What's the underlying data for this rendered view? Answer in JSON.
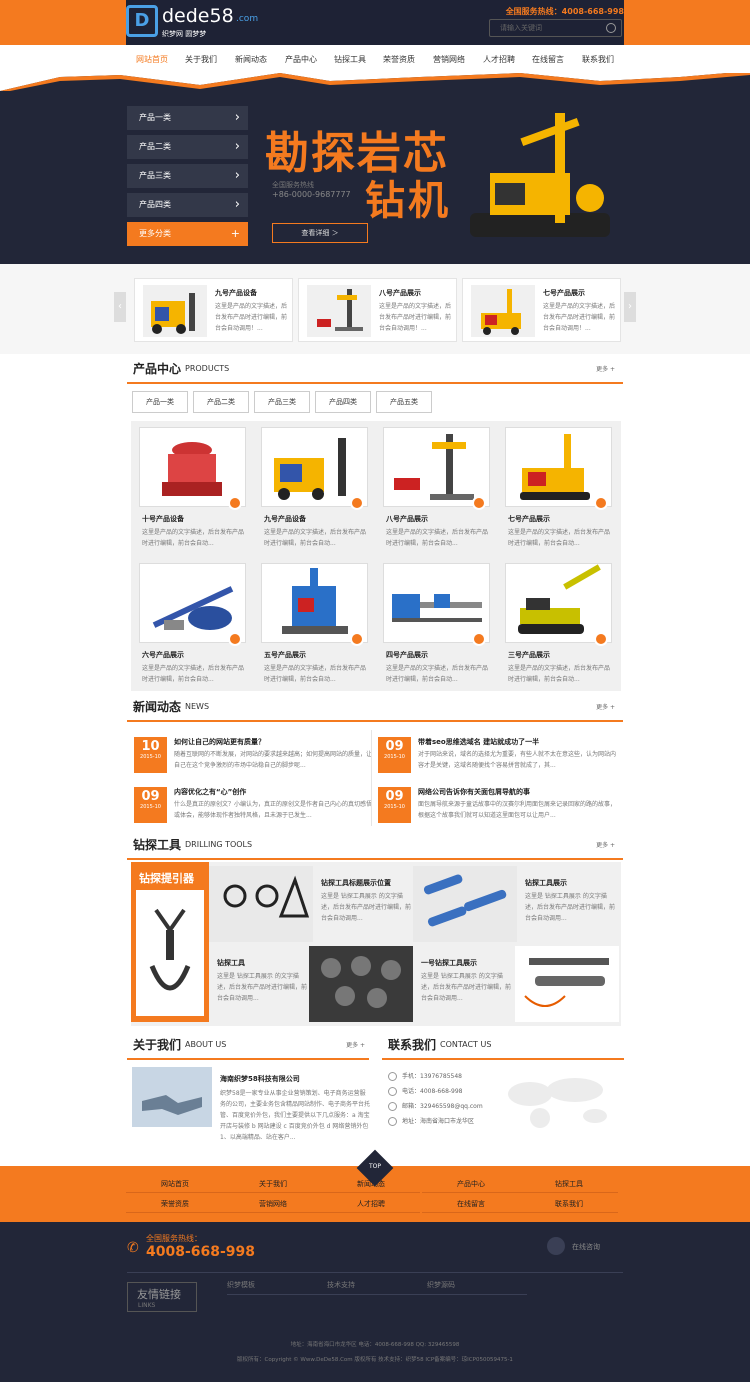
{
  "header": {
    "logo_text": "dede58",
    "logo_com": ".com",
    "logo_mark": "D",
    "slogan": "织梦网 圆梦梦",
    "hotline_label": "全国服务热线：4008-668-998",
    "search_placeholder": "请输入关键词"
  },
  "colors": {
    "accent": "#f47a1f",
    "dark": "#222638"
  },
  "nav": [
    "网站首页",
    "关于我们",
    "新闻动态",
    "产品中心",
    "钻探工具",
    "荣誉资质",
    "营销网络",
    "人才招聘",
    "在线留言",
    "联系我们"
  ],
  "banner": {
    "categories": [
      "产品一类",
      "产品二类",
      "产品三类",
      "产品四类"
    ],
    "more_categories": "更多分类",
    "title_line1": "勘探岩芯",
    "title_line2": "钻机",
    "hotline_small": "全国服务热线",
    "hotline_small_num": "+86-0000-9687777",
    "detail_button": "查看详细 ＞"
  },
  "slider": [
    {
      "title": "九号产品设备",
      "desc": "这里是产品的文字描述，后台发布产品时进行编辑，前台会自动调用！..."
    },
    {
      "title": "八号产品展示",
      "desc": "这里是产品的文字描述，后台发布产品时进行编辑，前台会自动调用！..."
    },
    {
      "title": "七号产品展示",
      "desc": "这里是产品的文字描述，后台发布产品时进行编辑，前台会自动调用！..."
    }
  ],
  "products": {
    "title": "产品中心",
    "title_en": "PRODUCTS",
    "more": "更多 +",
    "tabs": [
      "产品一类",
      "产品二类",
      "产品三类",
      "产品四类",
      "产品五类"
    ],
    "items": [
      {
        "title": "十号产品设备",
        "desc": "这里是产品的文字描述，后台发布产品时进行编辑，前台会自动..."
      },
      {
        "title": "九号产品设备",
        "desc": "这里是产品的文字描述，后台发布产品时进行编辑，前台会自动..."
      },
      {
        "title": "八号产品展示",
        "desc": "这里是产品的文字描述，后台发布产品时进行编辑，前台会自动..."
      },
      {
        "title": "七号产品展示",
        "desc": "这里是产品的文字描述，后台发布产品时进行编辑，前台会自动..."
      },
      {
        "title": "六号产品展示",
        "desc": "这里是产品的文字描述，后台发布产品时进行编辑，前台会自动..."
      },
      {
        "title": "五号产品展示",
        "desc": "这里是产品的文字描述，后台发布产品时进行编辑，前台会自动..."
      },
      {
        "title": "四号产品展示",
        "desc": "这里是产品的文字描述，后台发布产品时进行编辑，前台会自动..."
      },
      {
        "title": "三号产品展示",
        "desc": "这里是产品的文字描述，后台发布产品时进行编辑，前台会自动..."
      }
    ]
  },
  "news": {
    "title": "新闻动态",
    "title_en": "NEWS",
    "more": "更多 +",
    "items": [
      {
        "day": "10",
        "ym": "2015-10",
        "title": "如何让自己的网站更有质量？",
        "desc": "随着互联网的不断发展，对网站的要求越来越高；如何提高网站的质量，让自己在这个竞争激烈的市场中站稳自己的脚步呢..."
      },
      {
        "day": "09",
        "ym": "2015-10",
        "title": "带着seo思维选域名 建站就成功了一半",
        "desc": "对于网站来说，域名的选择尤为重要，有些人就不太在意这些，认为网站内容才是关键，这域名随便找个容易拼音就成了，其..."
      },
      {
        "day": "09",
        "ym": "2015-10",
        "title": "内容优化之有“心”创作",
        "desc": "什么是真正的原创文？小编认为，真正的原创文是作者自己内心的真切感悟或体会，能够体现作者独特风格，且未源于已发生..."
      },
      {
        "day": "09",
        "ym": "2015-10",
        "title": "网络公司告诉你有关面包屑导航的事",
        "desc": "面包屑导航来源于童话故事中的汉赛尔利用面包屑来记录回家的路的故事，根据这个故事我们就可以知道这里面包可以让用户..."
      }
    ]
  },
  "tools": {
    "title": "钻探工具",
    "title_en": "DRILLING TOOLS",
    "more": "更多 +",
    "banner_text": "钻探提引器",
    "items": [
      {
        "title": "钻探工具标题展示位置",
        "desc": "这里是 钻探工具展示 的文字描述，后台发布产品时进行编辑，前台会自动调用..."
      },
      {
        "title": "钻探工具展示",
        "desc": "这里是 钻探工具展示 的文字描述，后台发布产品时进行编辑，前台会自动调用..."
      },
      {
        "title": "钻探工具",
        "desc": "这里是 钻探工具展示 的文字描述，后台发布产品时进行编辑，前台会自动调用..."
      },
      {
        "title": "一号钻探工具展示",
        "desc": "这里是 钻探工具展示 的文字描述，后台发布产品时进行编辑，前台会自动调用..."
      }
    ]
  },
  "about": {
    "title": "关于我们",
    "title_en": "ABOUT US",
    "more": "更多 +",
    "company": "海南织梦58科技有限公司",
    "desc": "织梦58是一家专业从事企业营销策划、电子商务运营服务的公司，主要业务包含精品网站制作、电子商务平台托管、百度竞价外包，我们主要提供以下几点服务：a 淘宝开店与装修 b 网站建设 c 百度竞价外包 d 网络营销外包 1、以高端精品、站在客户..."
  },
  "contact": {
    "title": "联系我们",
    "title_en": "CONTACT US",
    "items": [
      "手机：13976785548",
      "电话：4008-668-998",
      "邮箱：329465598@qq.com",
      "地址：海南省海口市龙华区"
    ]
  },
  "footer_nav": [
    "网站首页",
    "关于我们",
    "新闻动态",
    "产品中心",
    "钻探工具",
    "荣誉资质",
    "营销网络",
    "人才招聘",
    "在线留言",
    "联系我们"
  ],
  "top_label": "TOP",
  "footer": {
    "hotline_label": "全国服务热线：",
    "hotline": "4008-668-998",
    "online": "在线咨询",
    "friends_zh": "友情链接",
    "friends_en": "LINKS",
    "links": [
      "织梦模板",
      "技术支持",
      "织梦源码"
    ],
    "address": "地址：海南省海口市龙华区       电话：4008-668-998       QQ: 329465598",
    "copyright": "版权所有：Copyright © Www.DeDe58.Com 版权所有     技术支持：织梦58     ICP备案编号：琼ICP050059475-1"
  }
}
